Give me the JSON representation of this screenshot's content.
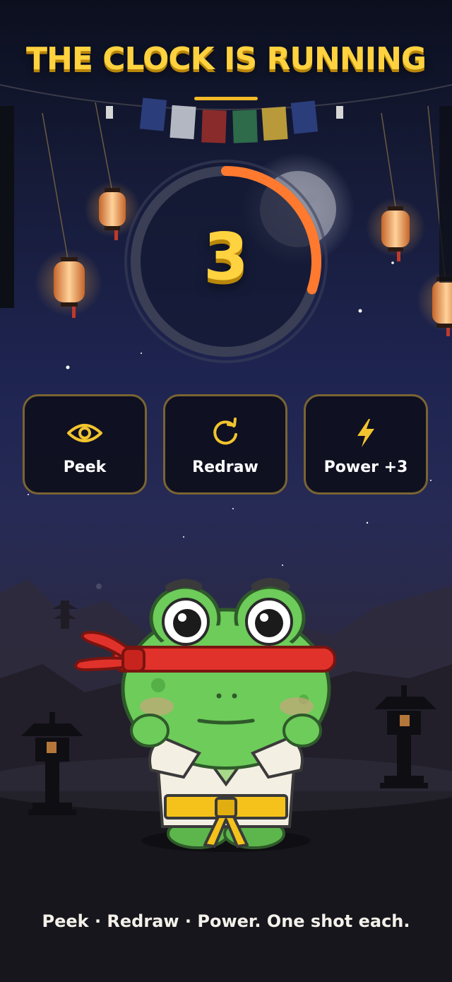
{
  "header": {
    "title": "THE CLOCK IS RUNNING"
  },
  "timer": {
    "value": "3",
    "progress": 0.3
  },
  "actions": [
    {
      "label": "Peek",
      "icon": "eye-icon"
    },
    {
      "label": "Redraw",
      "icon": "redraw-icon"
    },
    {
      "label": "Power +3",
      "icon": "lightning-icon"
    }
  ],
  "footer": {
    "hint": "Peek · Redraw · Power. One shot each."
  },
  "colors": {
    "accent_gold": "#ffd23f",
    "timer_arc": "#ff7a2e",
    "button_border": "#7a6433",
    "headband_red": "#e0322b",
    "frog_green": "#6dcc5a",
    "belt_yellow": "#f4c21b"
  }
}
